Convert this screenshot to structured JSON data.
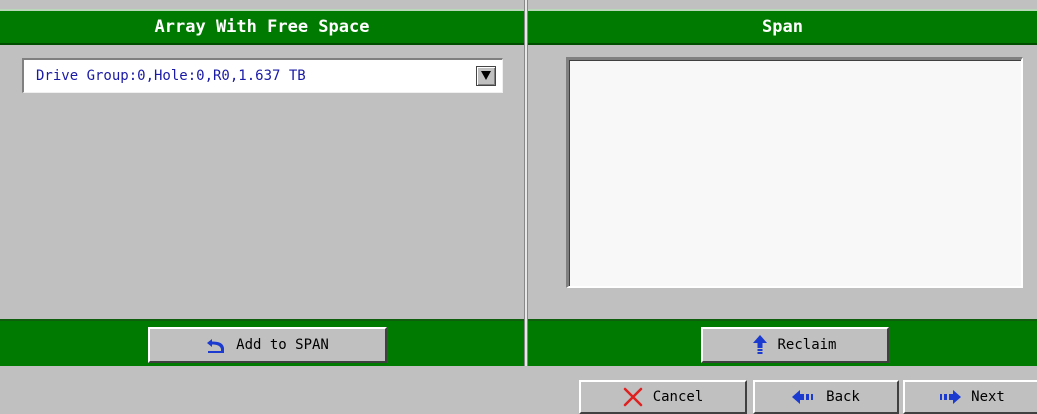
{
  "left_panel": {
    "header": "Array With Free Space",
    "combo_value": "Drive Group:0,Hole:0,R0,1.637 TB",
    "add_button": "Add to SPAN"
  },
  "right_panel": {
    "header": "Span",
    "reclaim_button": "Reclaim"
  },
  "bottom_bar": {
    "cancel": "Cancel",
    "back": "Back",
    "next": "Next"
  },
  "colors": {
    "header_green": "#007a00",
    "panel_gray": "#c0c0c0",
    "combo_text": "#1a1aa6",
    "cancel_icon": "#e02020",
    "nav_icon": "#1a3ad0"
  },
  "icons": {
    "combo_arrow": "chevron-down-icon",
    "add": "undo-icon",
    "reclaim": "up-arrow-icon",
    "cancel": "x-icon",
    "back": "left-arrow-icon",
    "next": "right-arrow-icon"
  }
}
